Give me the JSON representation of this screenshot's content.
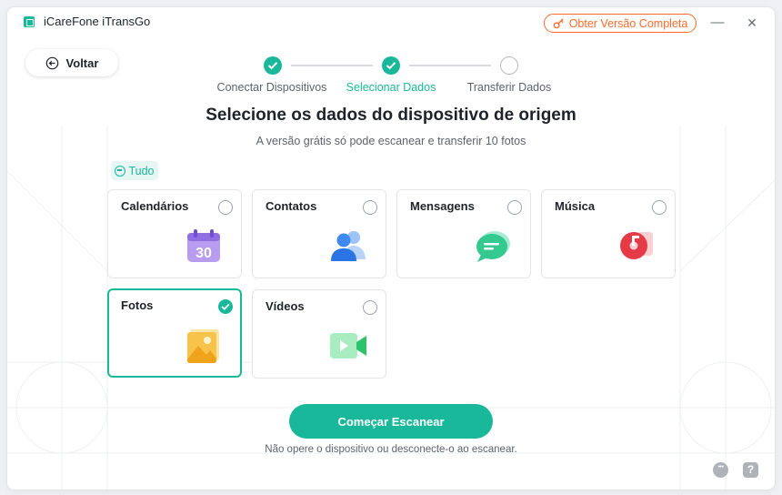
{
  "app": {
    "title": "iCareFone iTransGo",
    "upgrade_label": "Obter Versão Completa"
  },
  "window_controls": {
    "minimize": "—",
    "close": "✕"
  },
  "nav": {
    "back_label": "Voltar"
  },
  "steps": [
    {
      "label": "Conectar Dispositivos",
      "state": "done"
    },
    {
      "label": "Selecionar Dados",
      "state": "active"
    },
    {
      "label": "Transferir Dados",
      "state": "pending"
    }
  ],
  "heading": "Selecione os dados do dispositivo de origem",
  "subheading": "A versão grátis só pode escanear e transferir 10 fotos",
  "select_all_label": "Tudo",
  "categories": [
    {
      "label": "Calendários",
      "checked": false,
      "icon": "calendar-icon"
    },
    {
      "label": "Contatos",
      "checked": false,
      "icon": "contacts-icon"
    },
    {
      "label": "Mensagens",
      "checked": false,
      "icon": "messages-icon"
    },
    {
      "label": "Música",
      "checked": false,
      "icon": "music-icon"
    },
    {
      "label": "Fotos",
      "checked": true,
      "icon": "photos-icon"
    },
    {
      "label": "Vídeos",
      "checked": false,
      "icon": "videos-icon"
    }
  ],
  "calendar_day": "30",
  "scan_label": "Começar Escanear",
  "hint": "Não opere o dispositivo ou desconecte-o ao escanear.",
  "help_glyph": "?",
  "colors": {
    "accent": "#19b89b",
    "upgrade": "#ff6a2b",
    "text": "#1f2329",
    "muted": "#5d636b"
  }
}
